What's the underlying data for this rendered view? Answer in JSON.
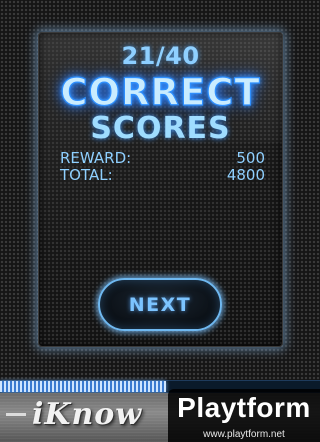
{
  "result": {
    "fraction": "21/40",
    "headline": "CORRECT",
    "subheadline": "SCORES"
  },
  "scores": [
    {
      "label": "REWARD:",
      "value": "500"
    },
    {
      "label": "TOTAL:",
      "value": "4800"
    }
  ],
  "next_label": "NEXT",
  "progress": 0.52,
  "brand": "iKnow",
  "watermark": {
    "logo": "Playtform",
    "url": "www.playtform.net"
  },
  "colors": {
    "accent": "#2e8fff",
    "text_blue": "#8fd0ff",
    "glow": "#6fb8f0"
  }
}
